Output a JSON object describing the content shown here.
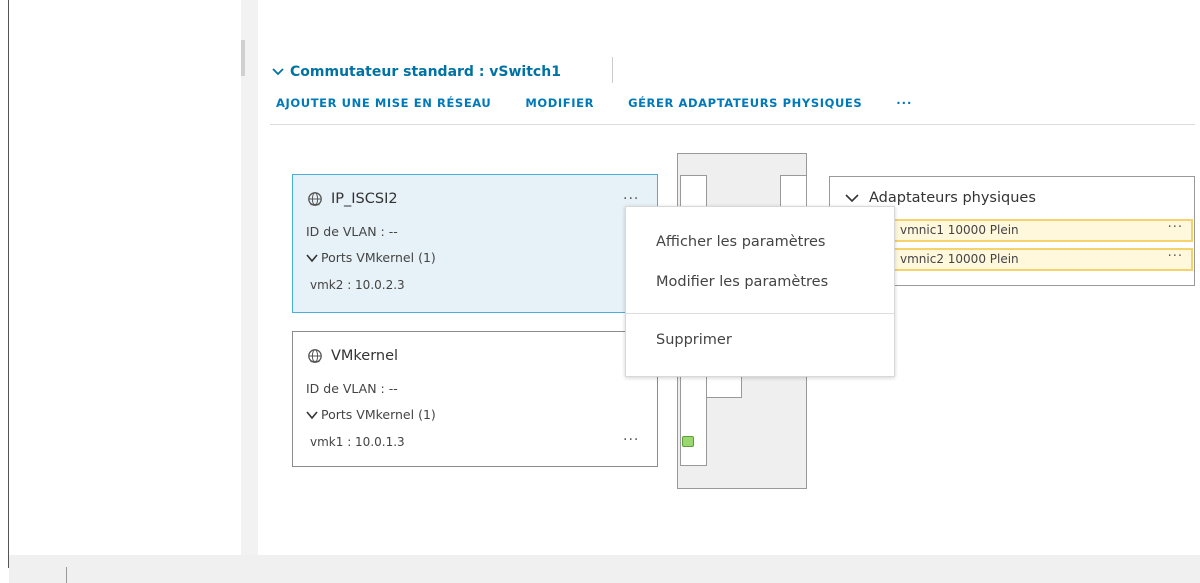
{
  "vswitch": {
    "header_title": "Commutateur standard : vSwitch1",
    "actions": [
      "AJOUTER UNE MISE EN RÉSEAU",
      "MODIFIER",
      "GÉRER ADAPTATEURS PHYSIQUES",
      "···"
    ]
  },
  "port_groups": [
    {
      "name": "IP_ISCSI2",
      "vlan": "ID de VLAN : --",
      "ports_label": "Ports VMkernel (1)",
      "vmk": "vmk2 : 10.0.2.3",
      "more": "···",
      "selected": true
    },
    {
      "name": "VMkernel",
      "vlan": "ID de VLAN : --",
      "ports_label": "Ports VMkernel (1)",
      "vmk": "vmk1 : 10.0.1.3",
      "more": "···",
      "selected": false
    }
  ],
  "physical_adapters": {
    "title": "Adaptateurs physiques",
    "items": [
      {
        "label": "vmnic1 10000 Plein",
        "more": "···"
      },
      {
        "label": "vmnic2 10000 Plein",
        "more": "···"
      }
    ]
  },
  "context_menu": {
    "items": [
      "Afficher les paramètres",
      "Modifier les paramètres",
      "Supprimer"
    ]
  },
  "colors": {
    "link": "#0079b8",
    "selected_card_bg": "#e7f1f8",
    "selected_card_border": "#49afd9",
    "nic_bg": "#fff8dc",
    "nic_border": "#f5d26b",
    "port_green": "#99d86f"
  },
  "icons": {
    "header_chevron": "chevron-down-icon",
    "port_group": "network-globe-icon",
    "ports_expand": "chevron-down-icon"
  }
}
